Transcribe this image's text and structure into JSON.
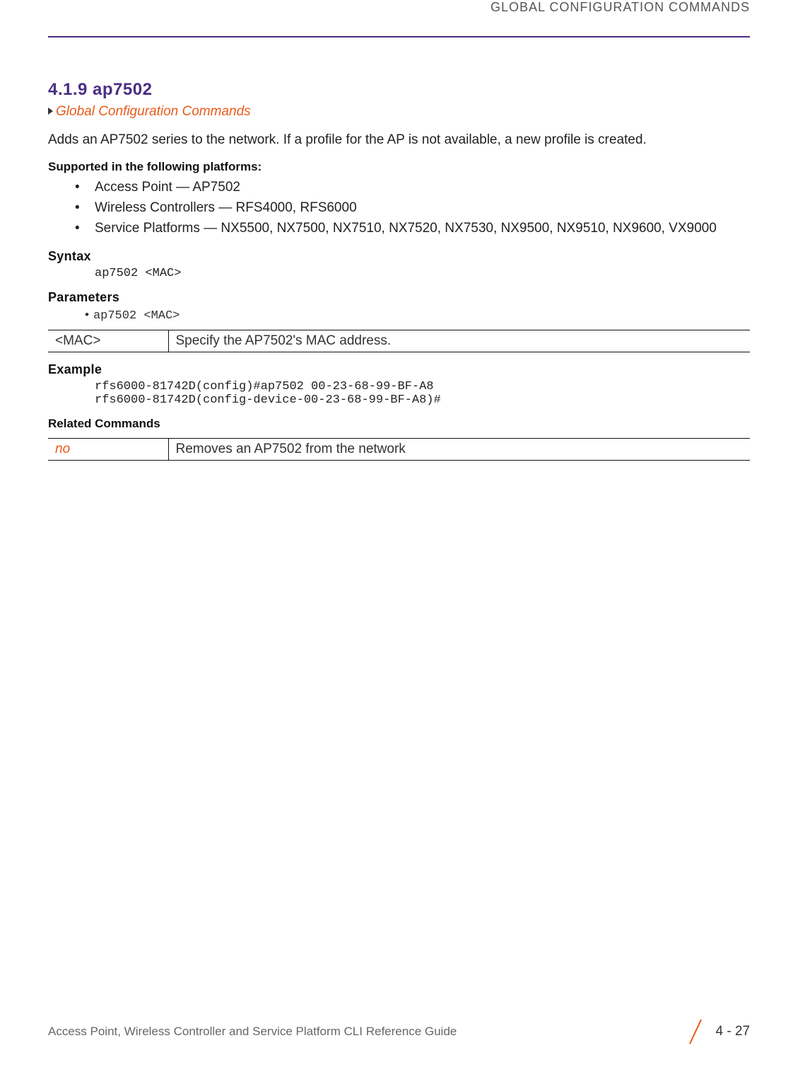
{
  "header": {
    "title": "GLOBAL CONFIGURATION COMMANDS"
  },
  "section": {
    "number": "4.1.9 ap7502",
    "breadcrumb": "Global Configuration Commands",
    "intro": "Adds an AP7502 series to the network. If a profile for the AP is not available, a new profile is created."
  },
  "supported": {
    "heading": "Supported in the following platforms:",
    "items": [
      "Access Point — AP7502",
      "Wireless Controllers — RFS4000, RFS6000",
      "Service Platforms — NX5500, NX7500, NX7510, NX7520, NX7530, NX9500, NX9510, NX9600, VX9000"
    ]
  },
  "syntax": {
    "heading": "Syntax",
    "code": "ap7502 <MAC>"
  },
  "parameters": {
    "heading": "Parameters",
    "line": "ap7502 <MAC>",
    "table": {
      "name": "<MAC>",
      "desc": "Specify the AP7502's MAC address."
    }
  },
  "example": {
    "heading": "Example",
    "code": "rfs6000-81742D(config)#ap7502 00-23-68-99-BF-A8\nrfs6000-81742D(config-device-00-23-68-99-BF-A8)#"
  },
  "related": {
    "heading": "Related Commands",
    "table": {
      "cmd": "no",
      "desc": "Removes an AP7502 from the network"
    }
  },
  "footer": {
    "left": "Access Point, Wireless Controller and Service Platform CLI Reference Guide",
    "page": "4 - 27"
  }
}
